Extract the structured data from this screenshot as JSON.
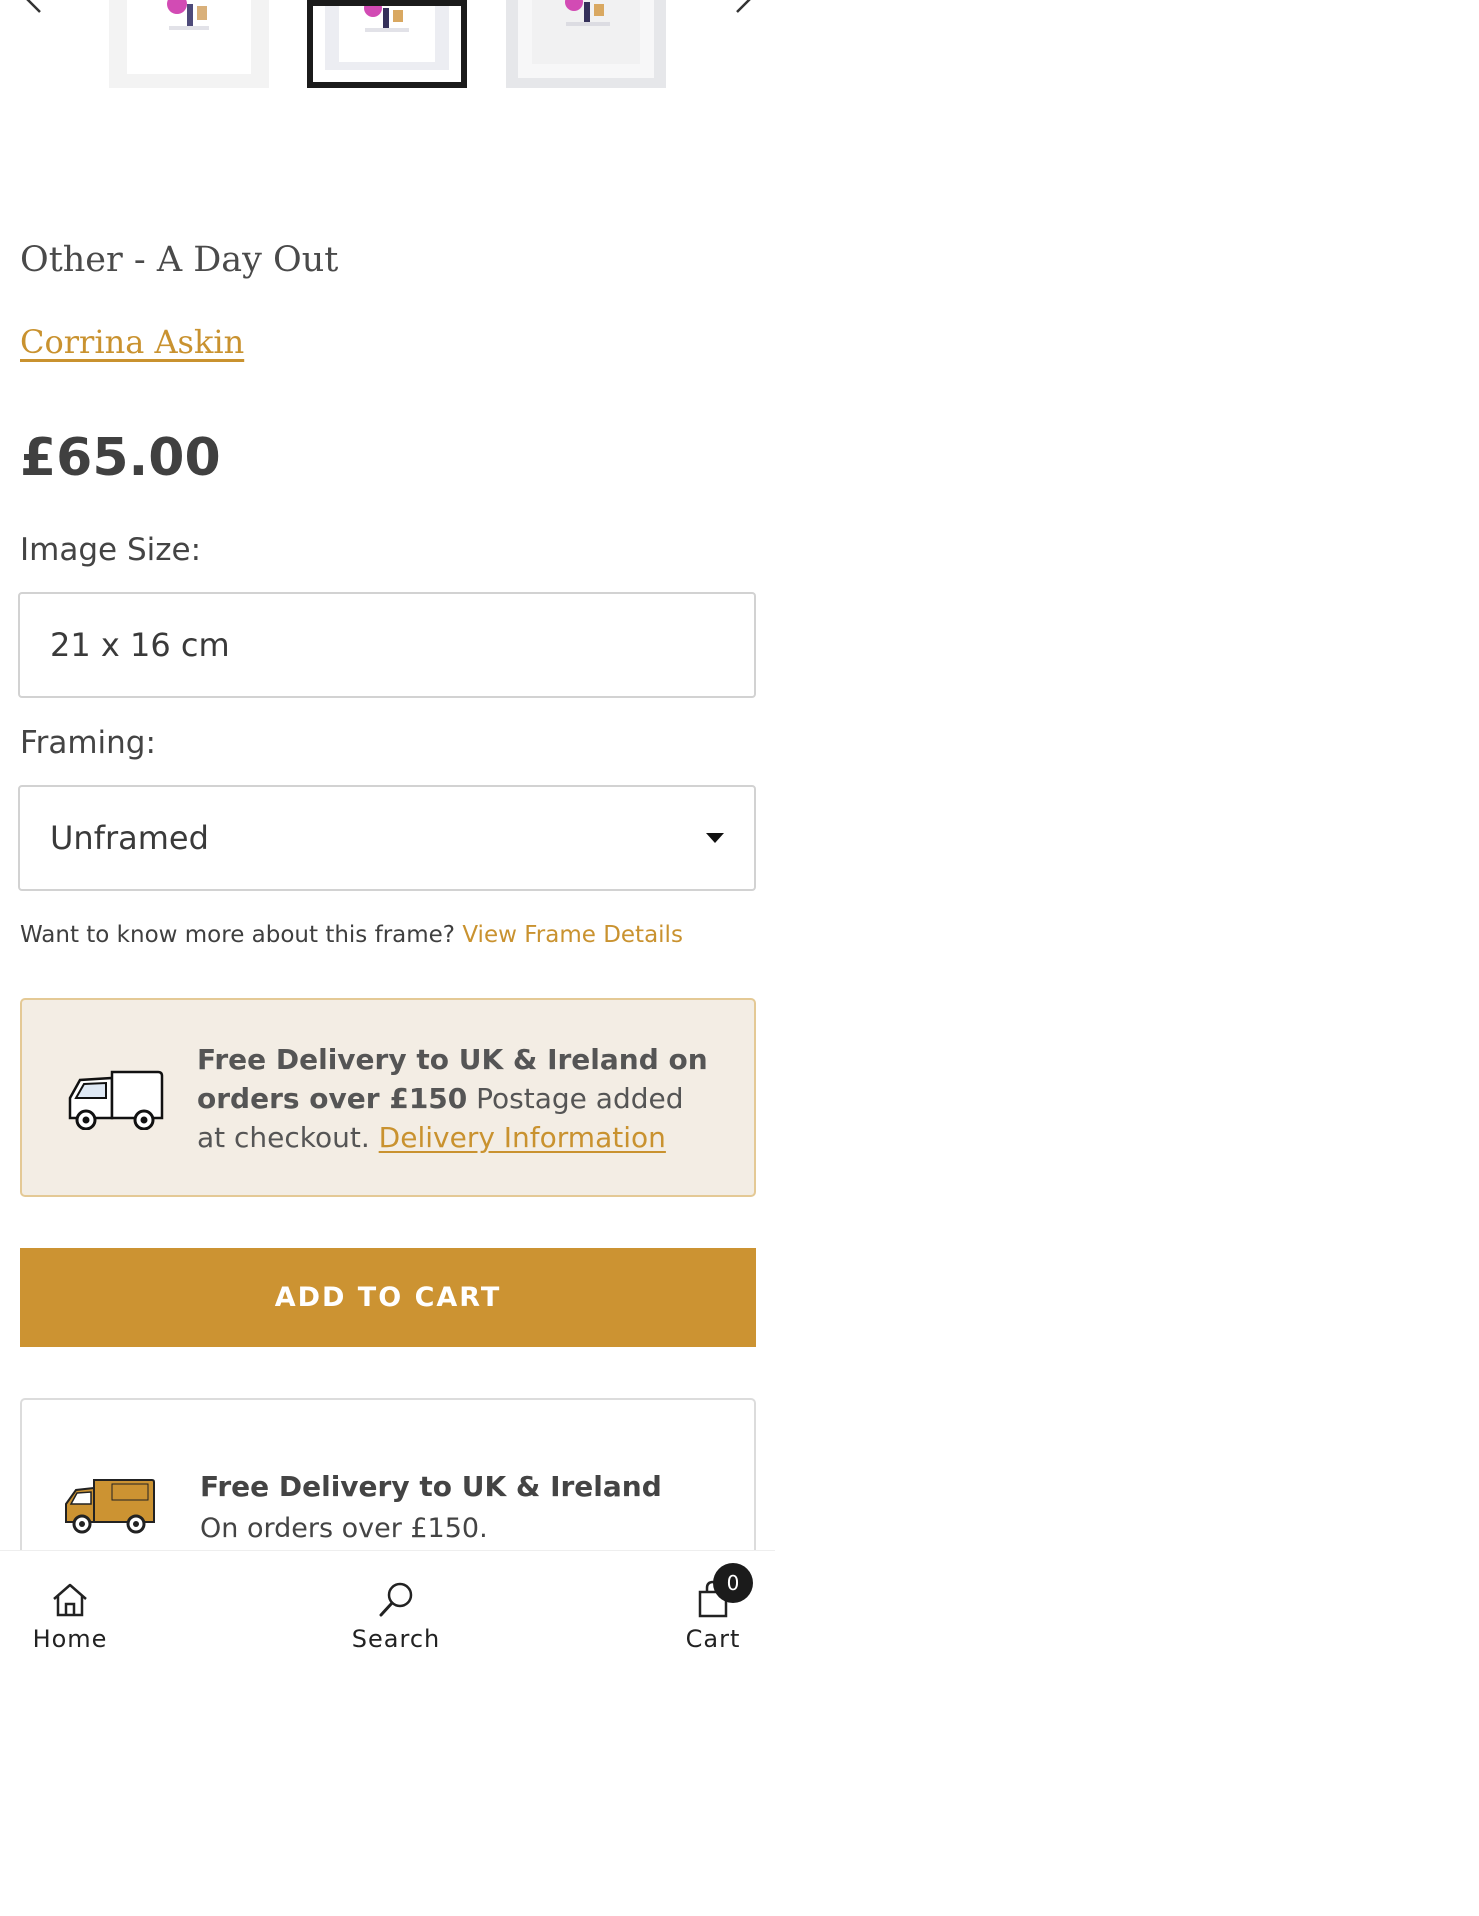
{
  "gallery": {
    "prev_icon": "chevron-left-icon",
    "next_icon": "chevron-right-icon",
    "thumbnails": [
      "unframed",
      "black-frame",
      "white-frame"
    ],
    "selected_thumbnail": 1
  },
  "product": {
    "title": "Other - A Day Out",
    "artist": "Corrina Askin",
    "price": "£65.00"
  },
  "options": {
    "size_label": "Image Size:",
    "size_value": "21 x 16 cm",
    "framing_label": "Framing:",
    "framing_value": "Unframed",
    "frame_question": "Want to know more about this frame?",
    "frame_link": "View Frame Details"
  },
  "delivery_notice": {
    "bold_text": "Free Delivery to UK & Ireland on orders over £150",
    "text": " Postage added at checkout. ",
    "link": "Delivery Information",
    "icon": "delivery-van-icon"
  },
  "add_to_cart": "ADD TO CART",
  "info_box": {
    "title": "Free Delivery to UK & Ireland",
    "subtitle": "On orders over £150.",
    "icon": "gallery-van-icon"
  },
  "bottom_nav": {
    "home": "Home",
    "search": "Search",
    "cart": "Cart",
    "cart_count": "0"
  },
  "colors": {
    "accent": "#cc9332",
    "notice_bg": "#f3ede4",
    "notice_border": "#e4c995",
    "text": "#3a3a3a"
  }
}
